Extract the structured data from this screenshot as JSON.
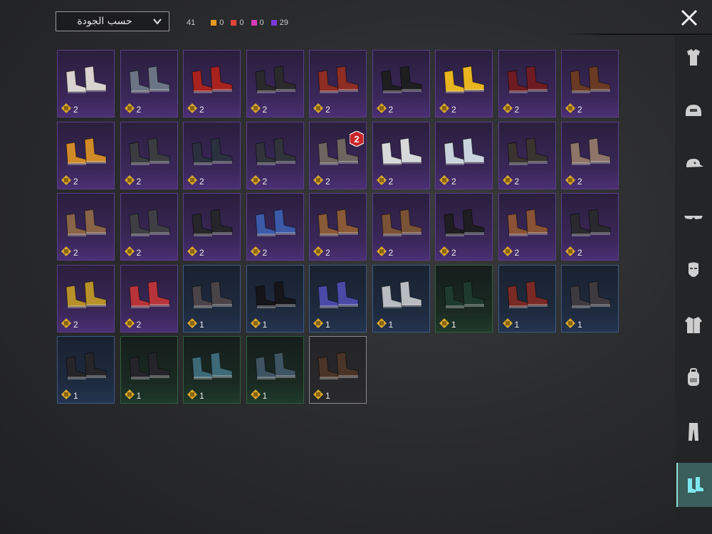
{
  "header": {
    "sort_label": "حسب الجودة",
    "total": "41",
    "counts": [
      {
        "name": "orange",
        "color": "#e39a1c",
        "value": "0"
      },
      {
        "name": "red",
        "color": "#e2453a",
        "value": "0"
      },
      {
        "name": "pink",
        "color": "#d63bb7",
        "value": "0"
      },
      {
        "name": "purple",
        "color": "#7a3bd6",
        "value": "29"
      }
    ]
  },
  "items": [
    {
      "tier": "purple",
      "color": "#d8d2d0",
      "qty": "2"
    },
    {
      "tier": "purple",
      "color": "#6b7484",
      "qty": "2"
    },
    {
      "tier": "purple",
      "color": "#a8231f",
      "qty": "2"
    },
    {
      "tier": "purple",
      "color": "#2a2a2c",
      "qty": "2"
    },
    {
      "tier": "purple",
      "color": "#8e2d24",
      "qty": "2"
    },
    {
      "tier": "purple",
      "color": "#1e1e20",
      "qty": "2"
    },
    {
      "tier": "purple",
      "color": "#e8b520",
      "qty": "2"
    },
    {
      "tier": "purple",
      "color": "#6e1c22",
      "qty": "2"
    },
    {
      "tier": "purple",
      "color": "#6a3a24",
      "qty": "2"
    },
    {
      "tier": "purple",
      "color": "#d08a28",
      "qty": "2"
    },
    {
      "tier": "purple",
      "color": "#3a3c40",
      "qty": "2"
    },
    {
      "tier": "purple",
      "color": "#2a3040",
      "qty": "2"
    },
    {
      "tier": "purple",
      "color": "#30343a",
      "qty": "2"
    },
    {
      "tier": "purple",
      "color": "#6e6460",
      "qty": "2",
      "tag": "2"
    },
    {
      "tier": "purple",
      "color": "#d6d8da",
      "qty": "2"
    },
    {
      "tier": "purple",
      "color": "#c9d3de",
      "qty": "2"
    },
    {
      "tier": "purple",
      "color": "#3a3430",
      "qty": "2"
    },
    {
      "tier": "purple",
      "color": "#8e7568",
      "qty": "2"
    },
    {
      "tier": "purple",
      "color": "#8a6448",
      "qty": "2"
    },
    {
      "tier": "purple",
      "color": "#3e3e44",
      "qty": "2"
    },
    {
      "tier": "purple",
      "color": "#26262a",
      "qty": "2"
    },
    {
      "tier": "purple",
      "color": "#3c5aa8",
      "qty": "2"
    },
    {
      "tier": "purple",
      "color": "#8a5a38",
      "qty": "2"
    },
    {
      "tier": "purple",
      "color": "#7a5236",
      "qty": "2"
    },
    {
      "tier": "purple",
      "color": "#1e1e22",
      "qty": "2"
    },
    {
      "tier": "purple",
      "color": "#8a5236",
      "qty": "2"
    },
    {
      "tier": "purple",
      "color": "#2a2a2e",
      "qty": "2"
    },
    {
      "tier": "purple",
      "color": "#b8902a",
      "qty": "2"
    },
    {
      "tier": "purple",
      "color": "#b8343a",
      "qty": "2"
    },
    {
      "tier": "blue",
      "color": "#4a4448",
      "qty": "1"
    },
    {
      "tier": "blue",
      "color": "#16161a",
      "qty": "1"
    },
    {
      "tier": "blue",
      "color": "#4a4aa6",
      "qty": "1"
    },
    {
      "tier": "blue",
      "color": "#b8bcc0",
      "qty": "1"
    },
    {
      "tier": "green",
      "color": "#1e3a2e",
      "qty": "1"
    },
    {
      "tier": "blue",
      "color": "#7a2a24",
      "qty": "1"
    },
    {
      "tier": "blue",
      "color": "#3e3a40",
      "qty": "1"
    },
    {
      "tier": "blue",
      "color": "#26262a",
      "qty": "1"
    },
    {
      "tier": "green",
      "color": "#24242a",
      "qty": "1"
    },
    {
      "tier": "green",
      "color": "#3e6a78",
      "qty": "1"
    },
    {
      "tier": "green",
      "color": "#3e5462",
      "qty": "1"
    },
    {
      "tier": "gray",
      "color": "#4a3428",
      "qty": "1"
    }
  ],
  "sidebar": [
    {
      "name": "outfit-icon",
      "active": false
    },
    {
      "name": "helmet-icon",
      "active": false
    },
    {
      "name": "cap-icon",
      "active": false
    },
    {
      "name": "glasses-icon",
      "active": false
    },
    {
      "name": "mask-icon",
      "active": false
    },
    {
      "name": "jacket-icon",
      "active": false
    },
    {
      "name": "backpack-icon",
      "active": false
    },
    {
      "name": "pants-icon",
      "active": false
    },
    {
      "name": "shoes-icon",
      "active": true
    }
  ]
}
